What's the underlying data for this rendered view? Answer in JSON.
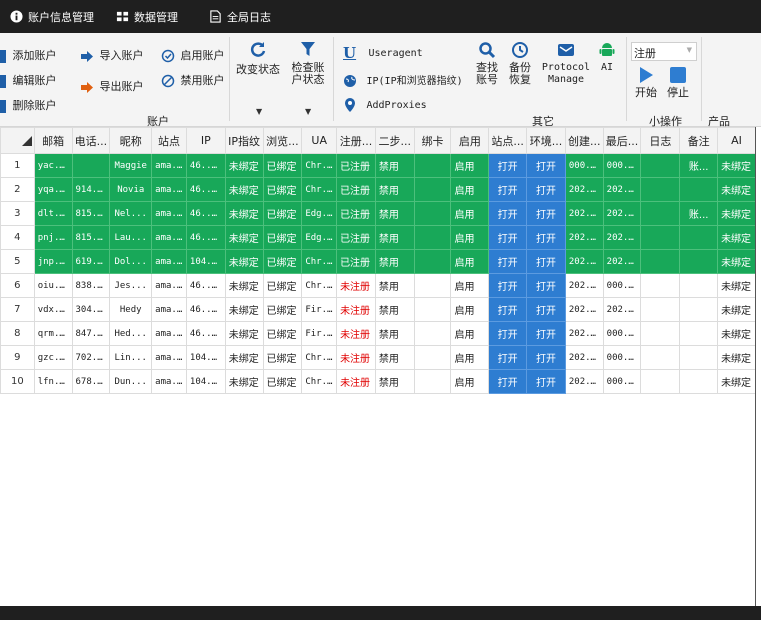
{
  "tabs": [
    {
      "label": "账户信息管理",
      "icon": "info-icon"
    },
    {
      "label": "数据管理",
      "icon": "grid-icon"
    },
    {
      "label": "全局日志",
      "icon": "document-icon"
    }
  ],
  "ribbon": {
    "account": {
      "add": "添加账户",
      "edit": "编辑账户",
      "delete": "删除账户",
      "import": "导入账户",
      "export": "导出账户",
      "enable": "启用账户",
      "disable": "禁用账户",
      "change_status": "改变状态",
      "check_status": "检查账\n户状态",
      "group_label": "账户"
    },
    "other": {
      "useragent": "Useragent",
      "ip": "IP(IP和浏览器指纹)",
      "proxies": "AddProxies",
      "find": "查找\n账号",
      "backup": "备份\n恢复",
      "protocol": "Protocol\nManage",
      "ai": "AI",
      "group_label": "其它"
    },
    "small_ops": {
      "select_value": "注册",
      "start": "开始",
      "stop": "停止",
      "group_label": "小操作"
    },
    "product": {
      "group_label": "产品"
    }
  },
  "colors": {
    "green": "#18a859",
    "blue": "#2e7dd1",
    "red": "#e00000",
    "titlebar": "#1f1f1f"
  },
  "table": {
    "headers": [
      "",
      "邮箱",
      "电话...",
      "昵称",
      "站点",
      "IP",
      "IP指纹",
      "浏览...",
      "UA",
      "注册...",
      "二步...",
      "绑卡",
      "启用",
      "站点...",
      "环境...",
      "创建...",
      "最后...",
      "日志",
      "备注",
      "AI"
    ],
    "rows": [
      {
        "style": "g",
        "cells": [
          "1",
          "yac...",
          "",
          "Maggie",
          "ama...",
          "46....",
          "未绑定",
          "已绑定",
          "Chr...",
          "已注册",
          "禁用",
          "",
          "启用",
          "打开",
          "打开",
          "000...",
          "000...",
          "",
          "账...",
          "未绑定"
        ]
      },
      {
        "style": "g",
        "cells": [
          "2",
          "yqa...",
          "914...",
          "Novia",
          "ama...",
          "46....",
          "未绑定",
          "已绑定",
          "Chr...",
          "已注册",
          "禁用",
          "",
          "启用",
          "打开",
          "打开",
          "202...",
          "202...",
          "",
          "",
          "未绑定"
        ]
      },
      {
        "style": "g",
        "cells": [
          "3",
          "dlt...",
          "815...",
          "Nel...",
          "ama...",
          "46....",
          "未绑定",
          "已绑定",
          "Edg...",
          "已注册",
          "禁用",
          "",
          "启用",
          "打开",
          "打开",
          "202...",
          "202...",
          "",
          "账...",
          "未绑定"
        ]
      },
      {
        "style": "g",
        "cells": [
          "4",
          "pnj...",
          "815...",
          "Lau...",
          "ama...",
          "46....",
          "未绑定",
          "已绑定",
          "Edg...",
          "已注册",
          "禁用",
          "",
          "启用",
          "打开",
          "打开",
          "202...",
          "202...",
          "",
          "",
          "未绑定"
        ]
      },
      {
        "style": "g",
        "cells": [
          "5",
          "jnp...",
          "619...",
          "Dol...",
          "ama...",
          "104...",
          "未绑定",
          "已绑定",
          "Chr...",
          "已注册",
          "禁用",
          "",
          "启用",
          "打开",
          "打开",
          "202...",
          "202...",
          "",
          "",
          "未绑定"
        ]
      },
      {
        "style": "w",
        "cells": [
          "6",
          "oiu...",
          "838...",
          "Jes...",
          "ama...",
          "46....",
          "未绑定",
          "已绑定",
          "Chr...",
          "未注册",
          "禁用",
          "",
          "启用",
          "打开",
          "打开",
          "202...",
          "000...",
          "",
          "",
          "未绑定"
        ]
      },
      {
        "style": "w",
        "cells": [
          "7",
          "vdx...",
          "304...",
          "Hedy",
          "ama...",
          "46....",
          "未绑定",
          "已绑定",
          "Fir...",
          "未注册",
          "禁用",
          "",
          "启用",
          "打开",
          "打开",
          "202...",
          "202...",
          "",
          "",
          "未绑定"
        ]
      },
      {
        "style": "w",
        "cells": [
          "8",
          "qrm...",
          "847...",
          "Hed...",
          "ama...",
          "46....",
          "未绑定",
          "已绑定",
          "Fir...",
          "未注册",
          "禁用",
          "",
          "启用",
          "打开",
          "打开",
          "202...",
          "000...",
          "",
          "",
          "未绑定"
        ]
      },
      {
        "style": "w",
        "cells": [
          "9",
          "gzc...",
          "702...",
          "Lin...",
          "ama...",
          "104...",
          "未绑定",
          "已绑定",
          "Chr...",
          "未注册",
          "禁用",
          "",
          "启用",
          "打开",
          "打开",
          "202...",
          "000...",
          "",
          "",
          "未绑定"
        ]
      },
      {
        "style": "w",
        "cells": [
          "10",
          "lfn...",
          "678...",
          "Dun...",
          "ama...",
          "104...",
          "未绑定",
          "已绑定",
          "Chr...",
          "未注册",
          "禁用",
          "",
          "启用",
          "打开",
          "打开",
          "202...",
          "000...",
          "",
          "",
          "未绑定"
        ]
      }
    ]
  }
}
